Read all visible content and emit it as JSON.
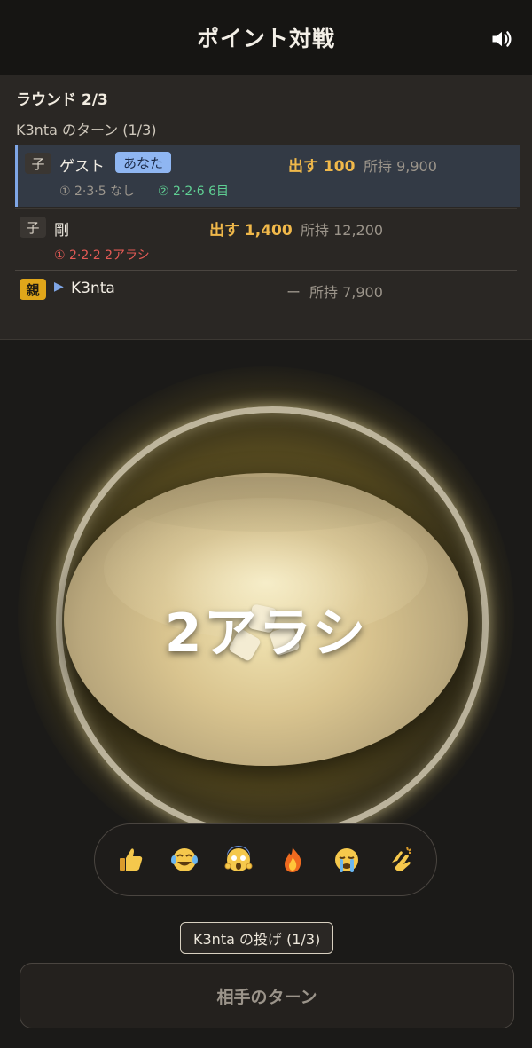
{
  "header": {
    "title": "ポイント対戦",
    "sound_icon": "speaker-icon"
  },
  "status": {
    "round": "ラウンド 2/3",
    "turn": "K3nta のターン (1/3)"
  },
  "players": [
    {
      "role": "子",
      "name": "ゲスト",
      "you_badge": "あなた",
      "bet": "出す 100",
      "holding": "所持 9,900",
      "roll1": "① 2·3·5 なし",
      "roll2": "② 2·2·6 6目"
    },
    {
      "role": "子",
      "name": "剛",
      "bet": "出す 1,400",
      "holding": "所持 12,200",
      "roll1": "① 2·2·2 2アラシ"
    },
    {
      "role": "親",
      "turn_marker": "▶",
      "name": "K3nta",
      "bet": "ー",
      "holding": "所持 7,900"
    }
  ],
  "result": {
    "text": "2アラシ"
  },
  "reactions": [
    {
      "icon": "thumbs-up-icon",
      "glyph": "👍"
    },
    {
      "icon": "tears-of-joy-icon",
      "glyph": "😂"
    },
    {
      "icon": "screaming-face-icon",
      "glyph": "😱"
    },
    {
      "icon": "fire-icon",
      "glyph": "🔥"
    },
    {
      "icon": "crying-face-icon",
      "glyph": "😭"
    },
    {
      "icon": "clapping-hands-icon",
      "glyph": "👏"
    }
  ],
  "throw_label": "K3nta の投げ (1/3)",
  "action_button": "相手のターン",
  "colors": {
    "accent_bet": "#f0b84a",
    "you_badge": "#8fb6f2",
    "parent_badge": "#e0a61a",
    "good_roll": "#5fcf93",
    "bad_roll": "#e45a55"
  }
}
